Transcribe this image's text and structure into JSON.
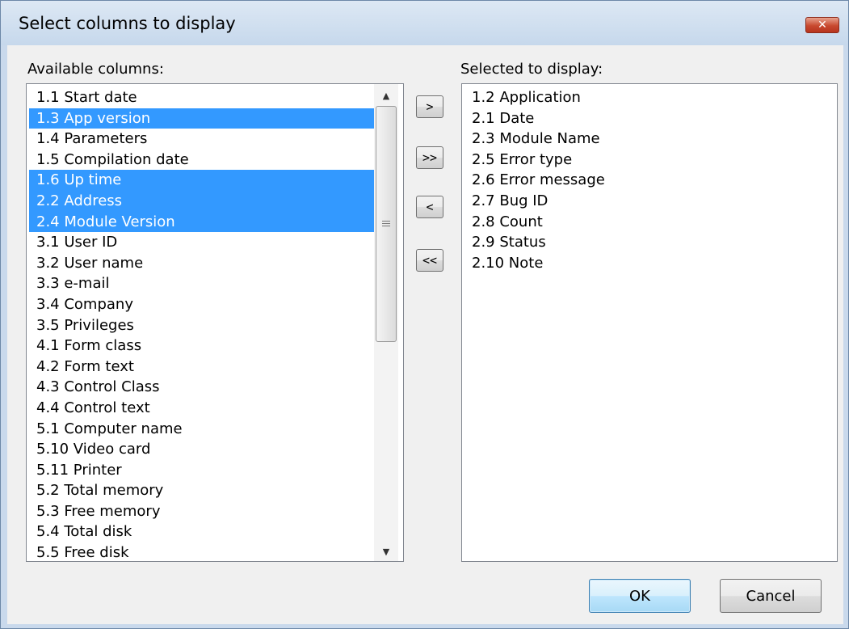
{
  "dialog": {
    "title": "Select columns to display",
    "close_symbol": "✕"
  },
  "available": {
    "label": "Available columns:",
    "items": [
      {
        "text": "1.1 Start date",
        "selected": false
      },
      {
        "text": "1.3 App version",
        "selected": true
      },
      {
        "text": "1.4 Parameters",
        "selected": false
      },
      {
        "text": "1.5 Compilation date",
        "selected": false
      },
      {
        "text": "1.6 Up time",
        "selected": true
      },
      {
        "text": "2.2 Address",
        "selected": true
      },
      {
        "text": "2.4 Module Version",
        "selected": true
      },
      {
        "text": "3.1 User ID",
        "selected": false
      },
      {
        "text": "3.2 User name",
        "selected": false
      },
      {
        "text": "3.3 e-mail",
        "selected": false
      },
      {
        "text": "3.4 Company",
        "selected": false
      },
      {
        "text": "3.5 Privileges",
        "selected": false
      },
      {
        "text": "4.1 Form class",
        "selected": false
      },
      {
        "text": "4.2 Form text",
        "selected": false
      },
      {
        "text": "4.3 Control Class",
        "selected": false
      },
      {
        "text": "4.4 Control text",
        "selected": false
      },
      {
        "text": "5.1 Computer name",
        "selected": false
      },
      {
        "text": "5.10 Video card",
        "selected": false
      },
      {
        "text": "5.11 Printer",
        "selected": false
      },
      {
        "text": "5.2 Total memory",
        "selected": false
      },
      {
        "text": "5.3 Free memory",
        "selected": false
      },
      {
        "text": "5.4 Total disk",
        "selected": false
      },
      {
        "text": "5.5 Free disk",
        "selected": false
      }
    ]
  },
  "selected": {
    "label": "Selected to display:",
    "items": [
      {
        "text": "1.2 Application"
      },
      {
        "text": "2.1 Date"
      },
      {
        "text": "2.3 Module Name"
      },
      {
        "text": "2.5 Error type"
      },
      {
        "text": "2.6 Error message"
      },
      {
        "text": "2.7 Bug ID"
      },
      {
        "text": "2.8 Count"
      },
      {
        "text": "2.9 Status"
      },
      {
        "text": "2.10 Note"
      }
    ]
  },
  "move_buttons": {
    "add": ">",
    "add_all": ">>",
    "remove": "<",
    "remove_all": "<<"
  },
  "scrollbar": {
    "up_arrow": "▲",
    "down_arrow": "▼"
  },
  "footer": {
    "ok": "OK",
    "cancel": "Cancel"
  },
  "colors": {
    "selection": "#3399ff",
    "titlebar": "#c6d8ec",
    "close_button": "#c8492f"
  }
}
